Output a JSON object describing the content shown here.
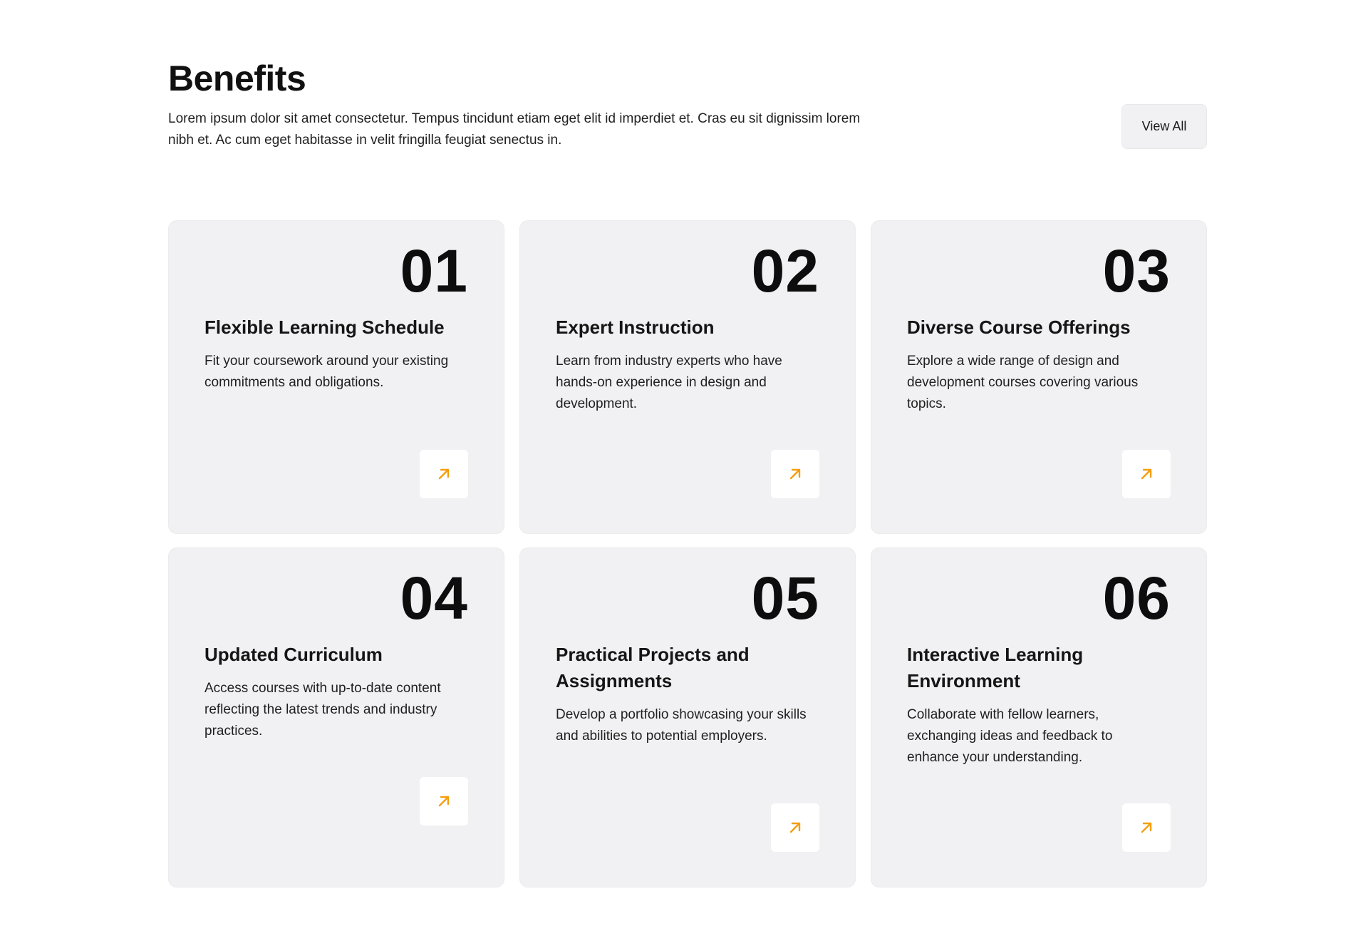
{
  "header": {
    "title": "Benefits",
    "subtitle": "Lorem ipsum dolor sit amet consectetur. Tempus tincidunt etiam eget elit id imperdiet et. Cras eu sit dignissim lorem nibh et. Ac cum eget habitasse in velit fringilla feugiat senectus in.",
    "view_all_label": "View All"
  },
  "cards": [
    {
      "number": "01",
      "title": "Flexible Learning Schedule",
      "description": "Fit your coursework around your existing commitments and obligations.",
      "icon": "arrow-up-right-icon"
    },
    {
      "number": "02",
      "title": "Expert Instruction",
      "description": "Learn from industry experts who have hands-on experience in design and development.",
      "icon": "arrow-up-right-icon"
    },
    {
      "number": "03",
      "title": "Diverse Course Offerings",
      "description": "Explore a wide range of design and development courses covering various topics.",
      "icon": "arrow-up-right-icon"
    },
    {
      "number": "04",
      "title": "Updated Curriculum",
      "description": "Access courses with up-to-date content reflecting the latest trends and industry practices.",
      "icon": "arrow-up-right-icon"
    },
    {
      "number": "05",
      "title": "Practical Projects and Assignments",
      "description": "Develop a portfolio showcasing your skills and abilities to potential employers.",
      "icon": "arrow-up-right-icon"
    },
    {
      "number": "06",
      "title": "Interactive Learning Environment",
      "description": "Collaborate with fellow learners, exchanging ideas and feedback to enhance your understanding.",
      "icon": "arrow-up-right-icon"
    }
  ],
  "colors": {
    "accent": "#f59e0b",
    "card_background": "#f1f1f3",
    "text": "#111111"
  }
}
